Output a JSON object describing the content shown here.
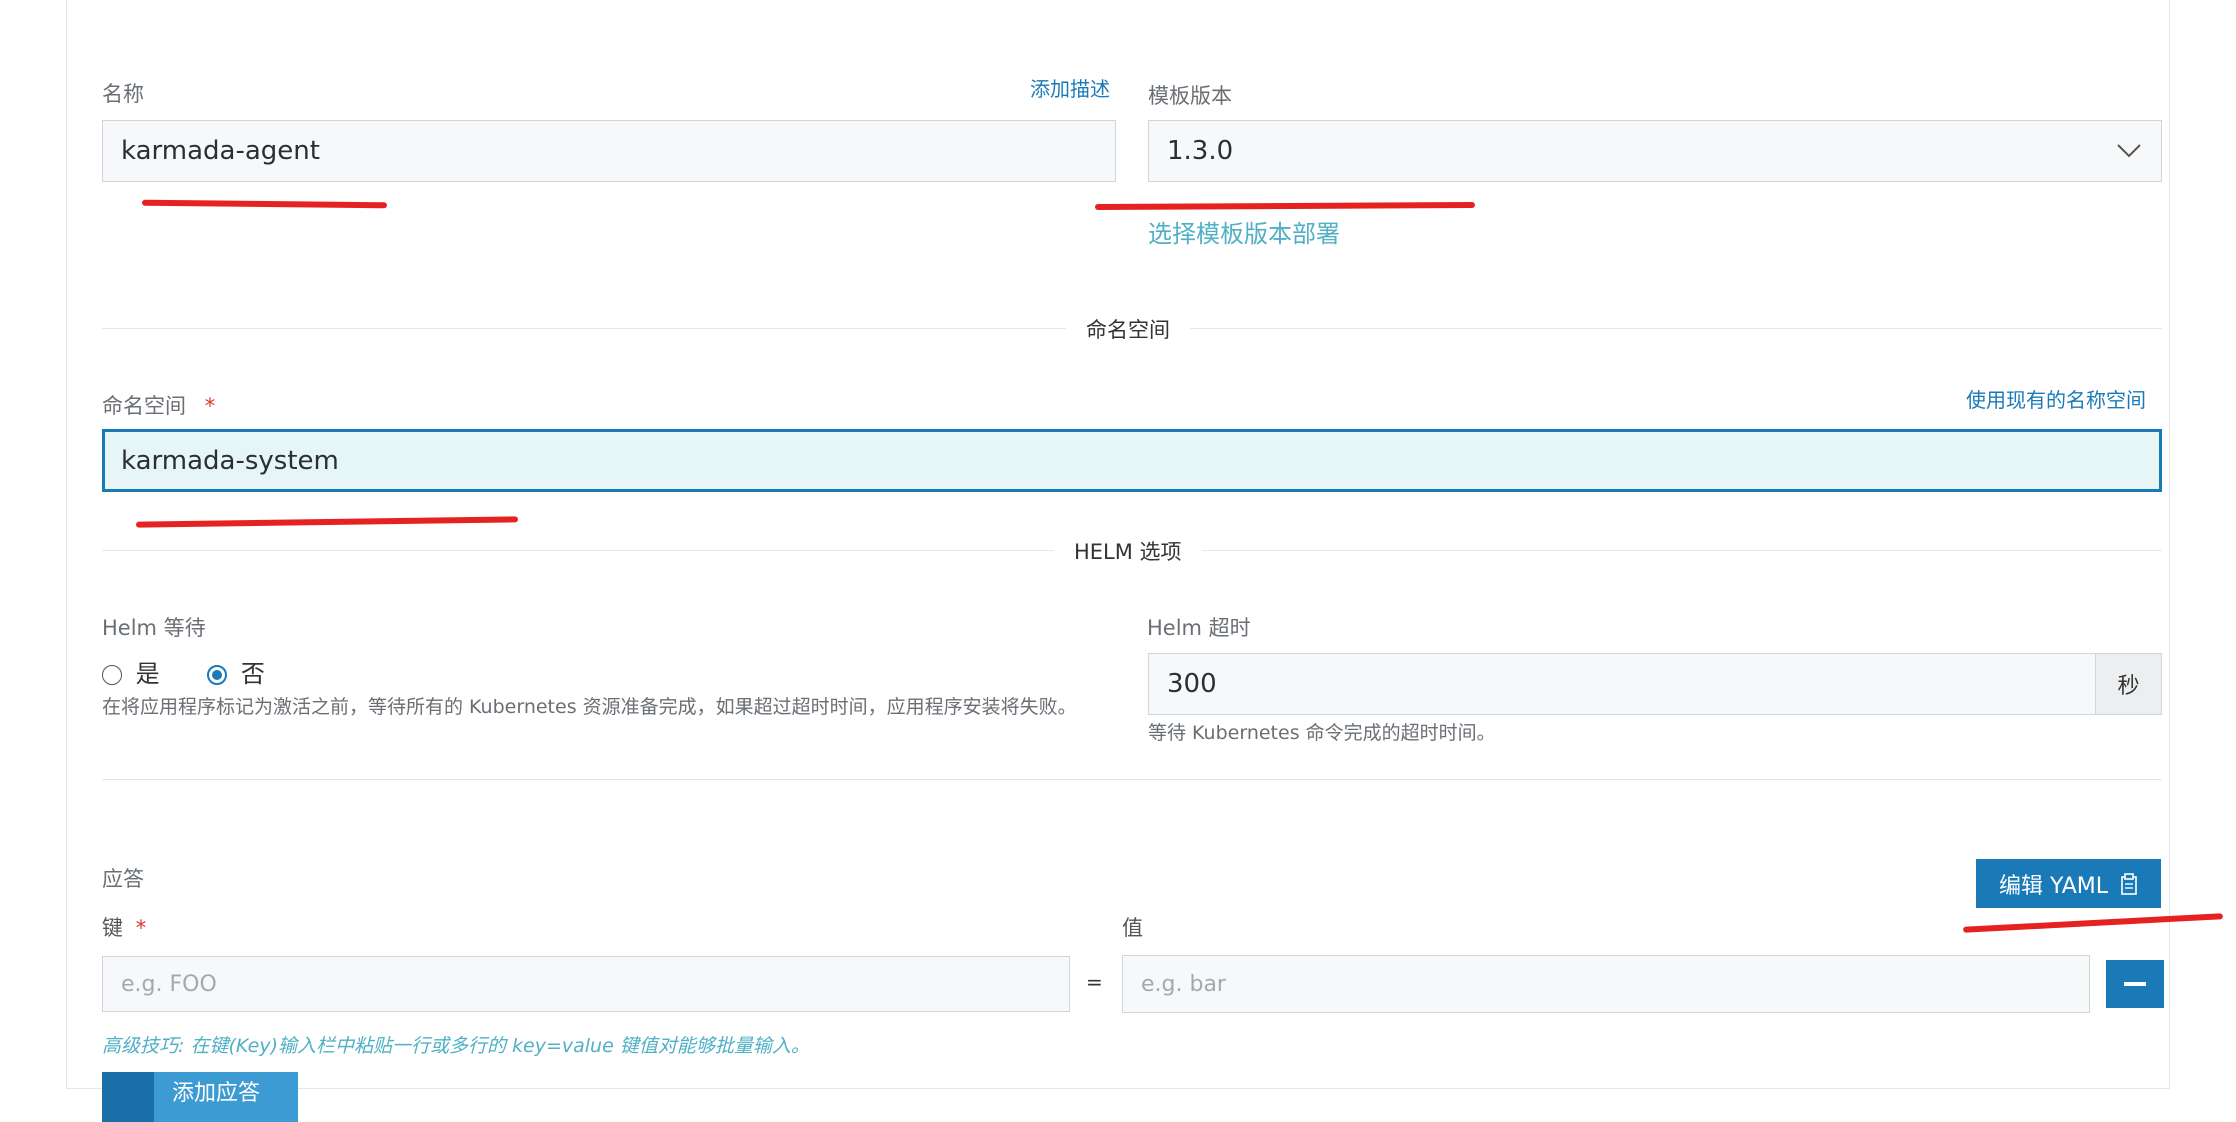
{
  "name_field": {
    "label": "名称",
    "add_description": "添加描述",
    "value": "karmada-agent"
  },
  "template_version": {
    "label": "模板版本",
    "value": "1.3.0",
    "select_link": "选择模板版本部署"
  },
  "namespace_section": {
    "title": "命名空间"
  },
  "namespace_field": {
    "label": "命名空间",
    "required_mark": "*",
    "use_existing": "使用现有的名称空间",
    "value": "karmada-system"
  },
  "helm_section": {
    "title": "HELM 选项"
  },
  "helm_wait": {
    "label": "Helm 等待",
    "options": [
      {
        "label": "是",
        "selected": false
      },
      {
        "label": "否",
        "selected": true
      }
    ],
    "help": "在将应用程序标记为激活之前，等待所有的 Kubernetes 资源准备完成，如果超过超时时间，应用程序安装将失败。"
  },
  "helm_timeout": {
    "label": "Helm 超时",
    "value": "300",
    "unit": "秒",
    "help": "等待 Kubernetes 命令完成的超时时间。"
  },
  "answers": {
    "label": "应答",
    "edit_yaml": "编辑 YAML",
    "key_label": "键",
    "key_required": "*",
    "value_label": "值",
    "key_placeholder": "e.g. FOO",
    "equals": "=",
    "value_placeholder": "e.g. bar",
    "tip": "高级技巧: 在键(Key)输入栏中粘贴一行或多行的 key=value 键值对能够批量输入。",
    "add_button": "添加应答"
  },
  "colors": {
    "accent": "#1a7ab8",
    "annotation": "#e5221f",
    "focus_bg": "#e6f5f5"
  }
}
